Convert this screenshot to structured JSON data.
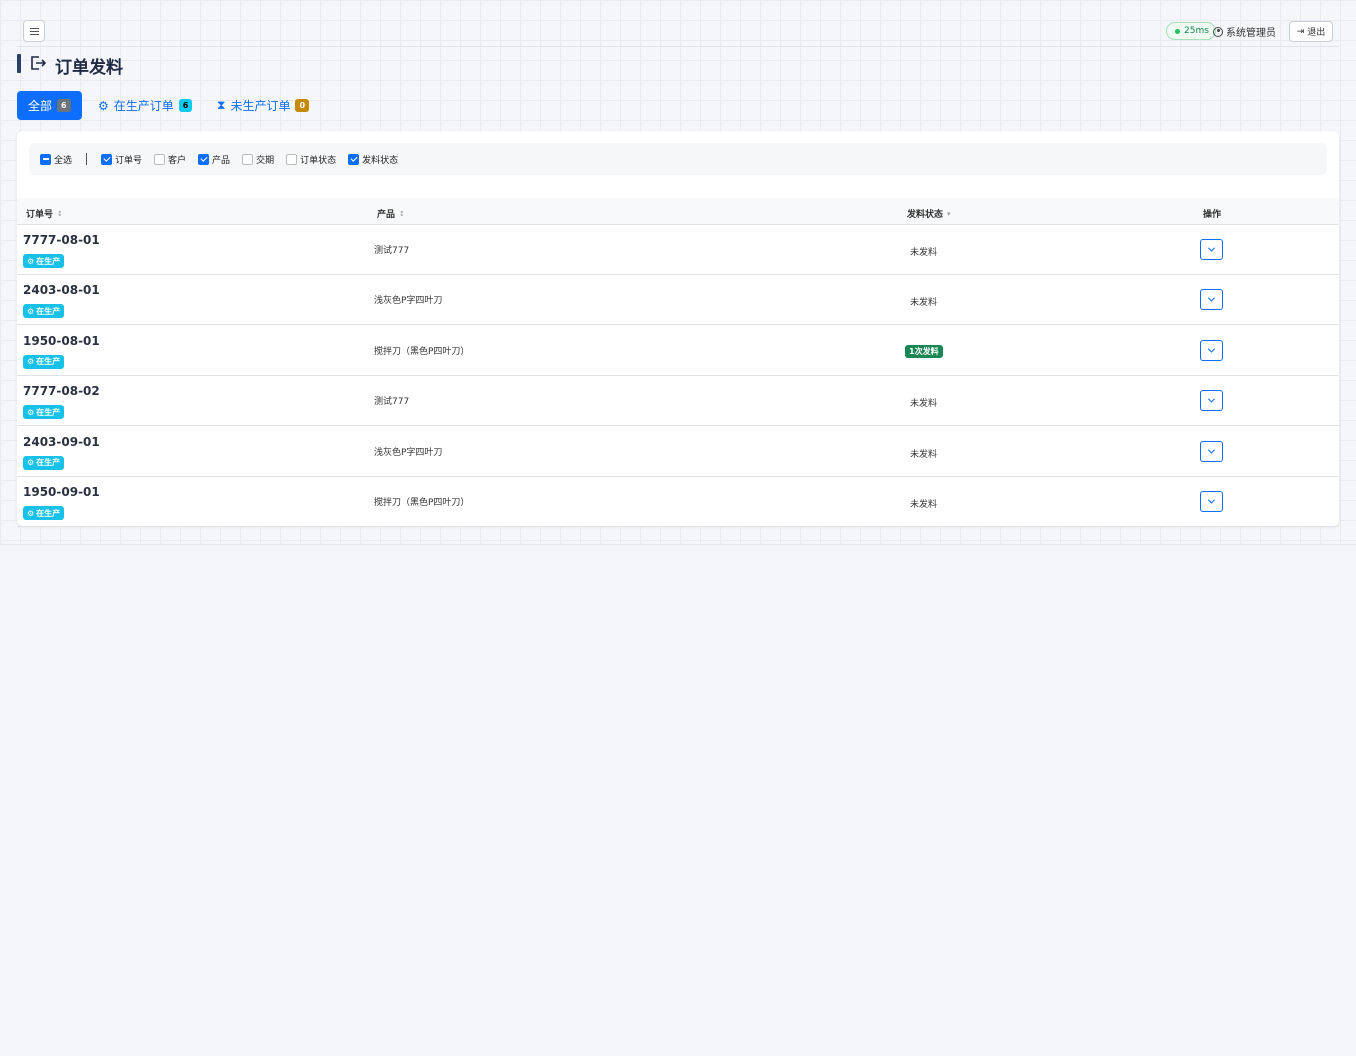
{
  "header": {
    "latency": "25ms",
    "user": "系统管理员",
    "logout": "退出"
  },
  "page": {
    "title": "订单发料"
  },
  "tabs": [
    {
      "label": "全部",
      "count": "6",
      "icon": ""
    },
    {
      "label": "在生产订单",
      "count": "6",
      "icon": "gear-icon"
    },
    {
      "label": "未生产订单",
      "count": "0",
      "icon": "hourglass-icon"
    }
  ],
  "filters": {
    "select_all": "全选",
    "columns": [
      {
        "label": "订单号",
        "checked": true
      },
      {
        "label": "客户",
        "checked": false
      },
      {
        "label": "产品",
        "checked": true
      },
      {
        "label": "交期",
        "checked": false
      },
      {
        "label": "订单状态",
        "checked": false
      },
      {
        "label": "发料状态",
        "checked": true
      }
    ]
  },
  "table": {
    "headers": {
      "order_no": "订单号",
      "product": "产品",
      "issue_status": "发料状态",
      "action": "操作"
    },
    "rows": [
      {
        "order_no": "7777-08-01",
        "badge": "在生产",
        "product": "测试777",
        "status": "未发料",
        "status_badge": false
      },
      {
        "order_no": "2403-08-01",
        "badge": "在生产",
        "product": "浅灰色P字四叶刀",
        "status": "未发料",
        "status_badge": false
      },
      {
        "order_no": "1950-08-01",
        "badge": "在生产",
        "product": "搅拌刀（黑色P四叶刀）",
        "status": "1次发料",
        "status_badge": true
      },
      {
        "order_no": "7777-08-02",
        "badge": "在生产",
        "product": "测试777",
        "status": "未发料",
        "status_badge": false
      },
      {
        "order_no": "2403-09-01",
        "badge": "在生产",
        "product": "浅灰色P字四叶刀",
        "status": "未发料",
        "status_badge": false
      },
      {
        "order_no": "1950-09-01",
        "badge": "在生产",
        "product": "搅拌刀（黑色P四叶刀）",
        "status": "未发料",
        "status_badge": false
      }
    ]
  },
  "colors": {
    "primary": "#0d6efd",
    "info": "#17c1e8",
    "success": "#198754",
    "warning": "#c58a00"
  }
}
